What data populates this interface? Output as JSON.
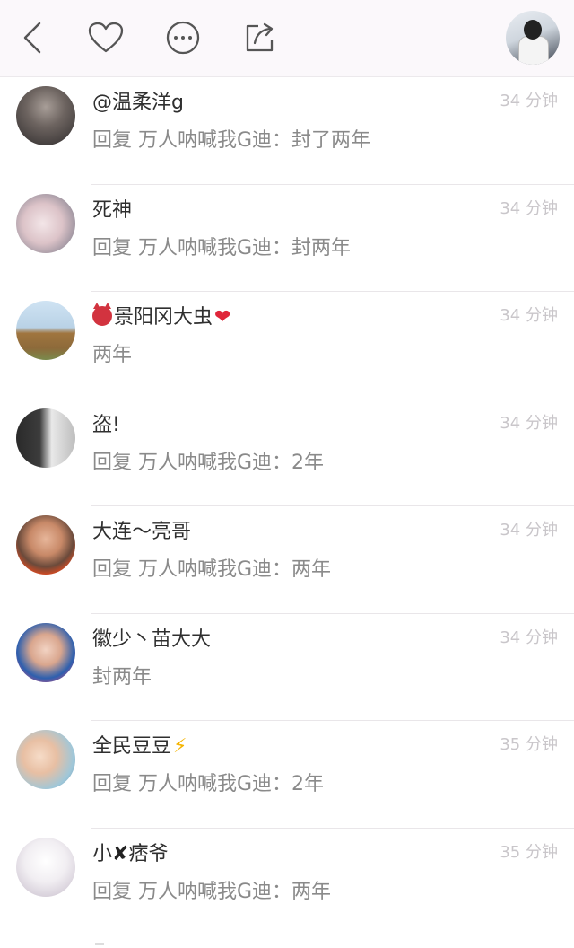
{
  "topbar": {
    "back_icon": "chevron-left-icon",
    "like_icon": "heart-outline-icon",
    "more_icon": "ellipsis-circle-icon",
    "share_icon": "share-square-icon",
    "avatar": "profile-avatar"
  },
  "comments": [
    {
      "name": "@温柔洋g",
      "text": "回复 万人呐喊我G迪：封了两年",
      "time": "34 分钟"
    },
    {
      "name": "死神",
      "text": "回复 万人呐喊我G迪：封两年",
      "time": "34 分钟"
    },
    {
      "name": "景阳冈大虫",
      "prefix_emoji": "devil-face",
      "suffix_emoji": "❤",
      "text": "两年",
      "time": "34 分钟"
    },
    {
      "name": "盗!",
      "text": "回复 万人呐喊我G迪：2年",
      "time": "34 分钟"
    },
    {
      "name": "大连～亮哥",
      "text": "回复 万人呐喊我G迪：两年",
      "time": "34 分钟"
    },
    {
      "name": "徽少丶苗大大",
      "text": "封两年",
      "time": "34 分钟"
    },
    {
      "name": "全民豆豆",
      "suffix_emoji": "⚡",
      "text": "回复 万人呐喊我G迪：2年",
      "time": "35 分钟"
    },
    {
      "name_a": "小",
      "name_x": "✘",
      "name_b": "痞爷",
      "text": "回复 万人呐喊我G迪：两年",
      "time": "35 分钟"
    }
  ],
  "colors": {
    "topbar_bg": "#fbf8fb",
    "name": "#2f2f2f",
    "text": "#8a8a8a",
    "time": "#c9c6ca",
    "divider": "#e9e6e9"
  }
}
